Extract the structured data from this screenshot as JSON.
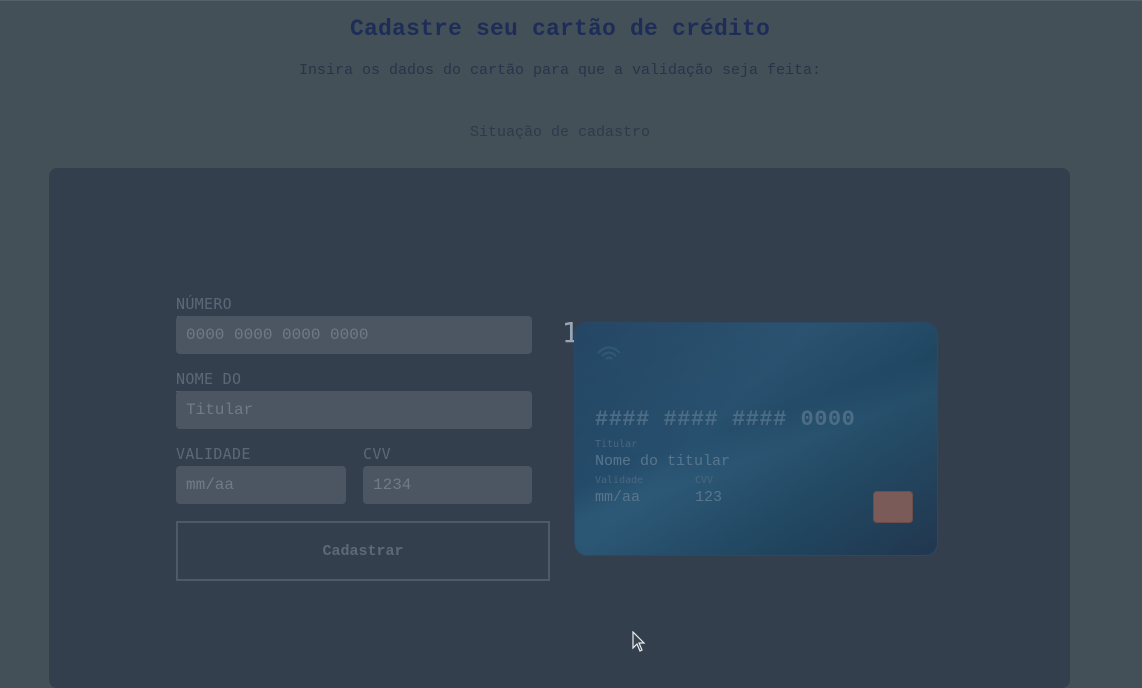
{
  "header": {
    "title": "Cadastre seu cartão de crédito",
    "subtitle": "Insira os dados do cartão para que a validação seja feita:",
    "status": "Situação de cadastro"
  },
  "form": {
    "number_label": "NÚMERO DO CARTÃO",
    "number_placeholder": "0000 0000 0000 0000",
    "holder_label": "NOME DO TITULAR",
    "holder_placeholder": "Titular",
    "expiry_label": "VALIDADE",
    "expiry_placeholder": "mm/aa",
    "cvv_label": "CVV",
    "cvv_placeholder": "1234",
    "submit_label": "Cadastrar"
  },
  "step_number": "1",
  "card": {
    "number": "#### #### #### 0000",
    "holder_caption": "Titular",
    "holder_value": "Nome do titular",
    "expiry_caption": "Validade",
    "expiry_value": "mm/aa",
    "cvv_caption": "CVV",
    "cvv_value": "123",
    "icons": [
      "contactless-icon",
      "chip-icon"
    ]
  },
  "colors": {
    "background": "#435058",
    "panel": "#343f4e",
    "title": "#1e2d58",
    "card": "#27506e",
    "chip": "#7a5b57"
  }
}
